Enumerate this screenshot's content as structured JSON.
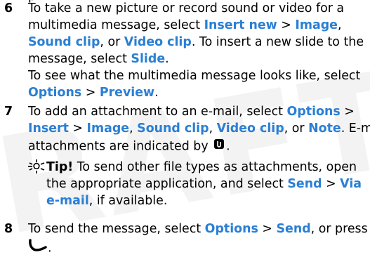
{
  "watermark": "RAFT",
  "steps": [
    {
      "number": "6",
      "lines": [
        [
          {
            "t": "To take a new picture or record sound or video for a"
          }
        ],
        [
          {
            "t": "multimedia message, select "
          },
          {
            "t": "Insert new",
            "h": 1
          },
          {
            "t": " > "
          },
          {
            "t": "Image",
            "h": 1
          },
          {
            "t": ","
          }
        ],
        [
          {
            "t": "Sound clip",
            "h": 1
          },
          {
            "t": ", or "
          },
          {
            "t": "Video clip",
            "h": 1
          },
          {
            "t": ". To insert a new slide to the"
          }
        ],
        [
          {
            "t": "message, select "
          },
          {
            "t": "Slide",
            "h": 1
          },
          {
            "t": "."
          }
        ],
        [
          {
            "t": "To see what the multimedia message looks like, select"
          }
        ],
        [
          {
            "t": "Options",
            "h": 1
          },
          {
            "t": " > "
          },
          {
            "t": "Preview",
            "h": 1
          },
          {
            "t": "."
          }
        ]
      ]
    },
    {
      "number": "7",
      "lines": [
        [
          {
            "t": "To add an attachment to an e-mail, select "
          },
          {
            "t": "Options",
            "h": 1
          },
          {
            "t": " >"
          }
        ],
        [
          {
            "t": "Insert",
            "h": 1
          },
          {
            "t": " > "
          },
          {
            "t": "Image",
            "h": 1
          },
          {
            "t": ", "
          },
          {
            "t": "Sound clip",
            "h": 1
          },
          {
            "t": ", "
          },
          {
            "t": "Video clip",
            "h": 1
          },
          {
            "t": ", or "
          },
          {
            "t": "Note",
            "h": 1
          },
          {
            "t": ". E-mail"
          }
        ],
        [
          {
            "t": "attachments are indicated by "
          },
          {
            "icon": "paperclip-icon"
          },
          {
            "t": "."
          }
        ]
      ]
    },
    {
      "number": "8",
      "lines": [
        [
          {
            "t": "To send the message, select "
          },
          {
            "t": "Options",
            "h": 1
          },
          {
            "t": " > "
          },
          {
            "t": "Send",
            "h": 1
          },
          {
            "t": ", or press"
          }
        ],
        [
          {
            "icon": "call-key-icon"
          },
          {
            "t": "."
          }
        ]
      ]
    }
  ],
  "tip": {
    "icon": "tip-icon",
    "lines": [
      [
        {
          "t": "Tip!",
          "b": 1
        },
        {
          "t": " To send other file types as attachments, open"
        }
      ],
      [
        {
          "t": "the appropriate application, and select "
        },
        {
          "t": "Send",
          "h": 1
        },
        {
          "t": " > "
        },
        {
          "t": "Via",
          "h": 1
        }
      ],
      [
        {
          "t": "e-mail",
          "h": 1
        },
        {
          "t": ", if available."
        }
      ]
    ]
  },
  "colors": {
    "highlight": "#2a7fd4",
    "watermark": "#f3f3f3"
  }
}
